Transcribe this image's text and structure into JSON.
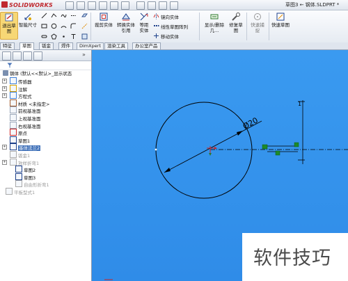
{
  "app": {
    "logo_text": "SOLIDWORKS",
    "document_title": "草图3 ← 钢体.SLDPRT *"
  },
  "ribbon": {
    "exit_sketch": "退出草图",
    "smart_dimension": "智能尺寸",
    "offset_entities": "裁剪实体",
    "convert_entities": "转换实体引用",
    "trim_entities": "等距实体",
    "mirror_entities": "镜向实体",
    "linear_pattern": "线性草图阵列",
    "move_entities": "移动实体",
    "display_delete_relations": "显示/删除几...",
    "repair_sketch": "修复草图",
    "rapid_sketch": "快速捕捉",
    "quick_sketch": "快速草图"
  },
  "tabs": [
    "特征",
    "草图",
    "钣金",
    "焊件",
    "DimXpert",
    "渲染工具",
    "办公室产品"
  ],
  "active_tab_index": 1,
  "tree": {
    "root": "钢体 (默认<<默认>_显示状态",
    "items": [
      {
        "label": "传感器"
      },
      {
        "label": "注解"
      },
      {
        "label": "方程式"
      },
      {
        "label": "材质 <未指定>"
      },
      {
        "label": "前视基准面"
      },
      {
        "label": "上视基准面"
      },
      {
        "label": "右视基准面"
      },
      {
        "label": "原点"
      },
      {
        "label": "草图1"
      },
      {
        "label": "基体法兰2"
      },
      {
        "label": "钣金1"
      },
      {
        "label": "放样折弯1"
      },
      {
        "label": "草图2"
      },
      {
        "label": "草图3"
      },
      {
        "label": "自由形折弯1"
      },
      {
        "label": "平板型式1"
      }
    ],
    "selected_label": "基体法兰2"
  },
  "sketch": {
    "dimension_text": "Ø20",
    "dimension_value": 20,
    "side_dimension": "1"
  },
  "watermark": "软件技巧",
  "colors": {
    "graphics_bg": "#2f8ce8",
    "sketch_line": "#000000",
    "relation_icon": "#1d8a2a",
    "selection": "#3d6fb8"
  }
}
